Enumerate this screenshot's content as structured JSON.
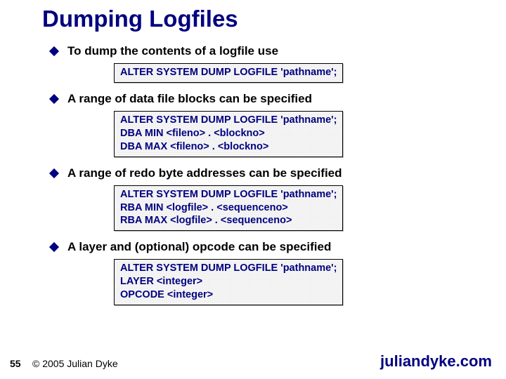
{
  "title": "Dumping Logfiles",
  "bullets": [
    "To dump the contents of a logfile use",
    "A range of data file blocks can be specified",
    "A range of redo byte addresses can be specified",
    "A layer and (optional) opcode can be specified"
  ],
  "code_boxes": [
    [
      "ALTER SYSTEM DUMP LOGFILE 'pathname';"
    ],
    [
      "ALTER SYSTEM DUMP LOGFILE 'pathname';",
      "DBA MIN <fileno> . <blockno>",
      "DBA MAX <fileno> . <blockno>"
    ],
    [
      "ALTER SYSTEM DUMP LOGFILE 'pathname';",
      "RBA MIN <logfile> . <sequenceno>",
      "RBA MAX <logfile> . <sequenceno>"
    ],
    [
      "ALTER SYSTEM DUMP LOGFILE 'pathname';",
      "LAYER <integer>",
      "OPCODE <integer>"
    ]
  ],
  "footer": {
    "page": "55",
    "copyright": "© 2005 Julian Dyke",
    "site": "juliandyke.com"
  }
}
